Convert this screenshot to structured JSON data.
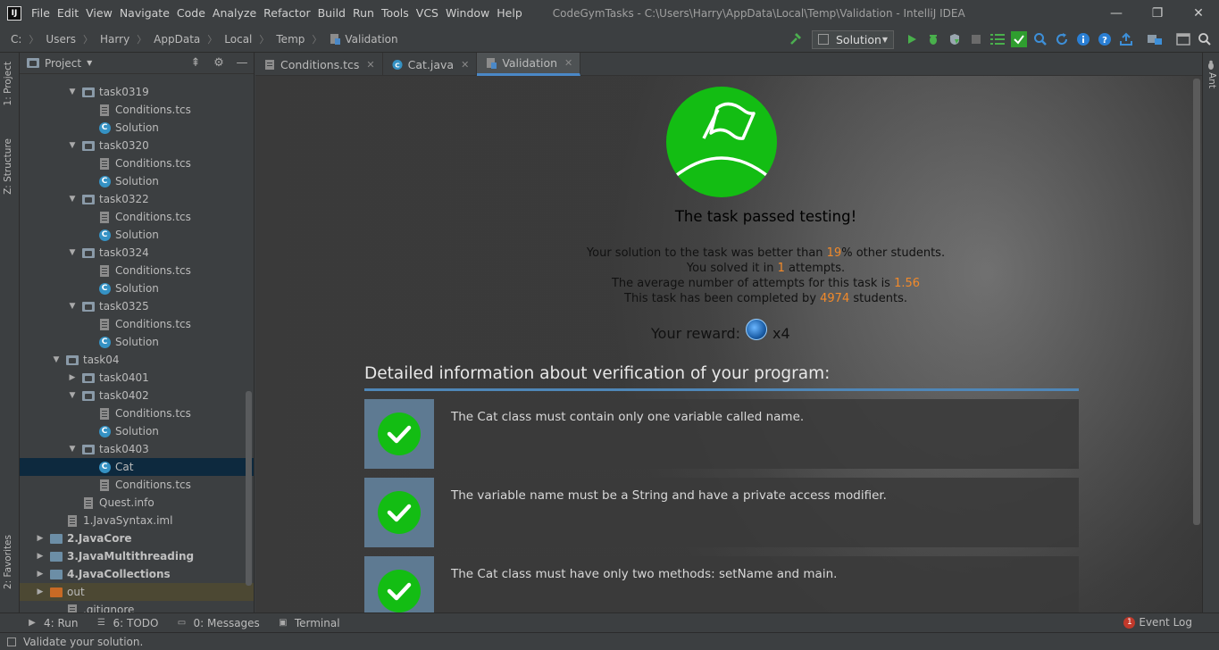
{
  "app": {
    "icon_letter": "IJ",
    "window_title": "CodeGymTasks - C:\\Users\\Harry\\AppData\\Local\\Temp\\Validation - IntelliJ IDEA",
    "menu": [
      "File",
      "Edit",
      "View",
      "Navigate",
      "Code",
      "Analyze",
      "Refactor",
      "Build",
      "Run",
      "Tools",
      "VCS",
      "Window",
      "Help"
    ]
  },
  "window_controls": {
    "minimize": "—",
    "restore": "❐",
    "close": "✕"
  },
  "breadcrumb": [
    "C:",
    "Users",
    "Harry",
    "AppData",
    "Local",
    "Temp",
    "Validation"
  ],
  "run_config": {
    "label": "Solution"
  },
  "left_strip": {
    "project": "1: Project",
    "structure": "Z: Structure",
    "favorites": "2: Favorites"
  },
  "right_strip": {
    "ant": "Ant"
  },
  "project_panel": {
    "title": "Project",
    "tree": [
      {
        "label": "task0319",
        "type": "folder",
        "depth": 2,
        "expanded": true
      },
      {
        "label": "Conditions.tcs",
        "type": "file",
        "depth": 3
      },
      {
        "label": "Solution",
        "type": "class",
        "depth": 3
      },
      {
        "label": "task0320",
        "type": "folder",
        "depth": 2,
        "expanded": true
      },
      {
        "label": "Conditions.tcs",
        "type": "file",
        "depth": 3
      },
      {
        "label": "Solution",
        "type": "class",
        "depth": 3
      },
      {
        "label": "task0322",
        "type": "folder",
        "depth": 2,
        "expanded": true
      },
      {
        "label": "Conditions.tcs",
        "type": "file",
        "depth": 3
      },
      {
        "label": "Solution",
        "type": "class",
        "depth": 3
      },
      {
        "label": "task0324",
        "type": "folder",
        "depth": 2,
        "expanded": true
      },
      {
        "label": "Conditions.tcs",
        "type": "file",
        "depth": 3
      },
      {
        "label": "Solution",
        "type": "class",
        "depth": 3
      },
      {
        "label": "task0325",
        "type": "folder",
        "depth": 2,
        "expanded": true
      },
      {
        "label": "Conditions.tcs",
        "type": "file",
        "depth": 3
      },
      {
        "label": "Solution",
        "type": "class",
        "depth": 3
      },
      {
        "label": "task04",
        "type": "folder",
        "depth": 1,
        "expanded": true
      },
      {
        "label": "task0401",
        "type": "folder",
        "depth": 2,
        "expanded": false
      },
      {
        "label": "task0402",
        "type": "folder",
        "depth": 2,
        "expanded": true
      },
      {
        "label": "Conditions.tcs",
        "type": "file",
        "depth": 3
      },
      {
        "label": "Solution",
        "type": "class",
        "depth": 3
      },
      {
        "label": "task0403",
        "type": "folder",
        "depth": 2,
        "expanded": true
      },
      {
        "label": "Cat",
        "type": "class",
        "depth": 3,
        "selected": true
      },
      {
        "label": "Conditions.tcs",
        "type": "file",
        "depth": 3
      },
      {
        "label": "Quest.info",
        "type": "file",
        "depth": 2
      },
      {
        "label": "1.JavaSyntax.iml",
        "type": "file",
        "depth": 1
      },
      {
        "label": "2.JavaCore",
        "type": "module",
        "depth": 0,
        "expanded": false,
        "bold": true
      },
      {
        "label": "3.JavaMultithreading",
        "type": "module",
        "depth": 0,
        "expanded": false,
        "bold": true
      },
      {
        "label": "4.JavaCollections",
        "type": "module",
        "depth": 0,
        "expanded": false,
        "bold": true
      },
      {
        "label": "out",
        "type": "out",
        "depth": 0,
        "expanded": false
      },
      {
        "label": ".gitignore",
        "type": "file",
        "depth": 1
      }
    ]
  },
  "tabs": [
    {
      "label": "Conditions.tcs",
      "active": false
    },
    {
      "label": "Cat.java",
      "active": false
    },
    {
      "label": "Validation",
      "active": true
    }
  ],
  "result": {
    "title": "The task passed testing!",
    "line1_pre": "Your solution to the task was better than ",
    "line1_val": "19",
    "line1_post": "% other students.",
    "line2_pre": "You solved it in ",
    "line2_val": "1",
    "line2_post": " attempts.",
    "line3_pre": "The average number of attempts for this task is ",
    "line3_val": "1.56",
    "line4_pre": "This task has been completed by ",
    "line4_val": "4974",
    "line4_post": " students.",
    "reward_label": "Your reward:",
    "reward_count": "x4",
    "highlight_color": "#f28a2a",
    "success_color": "#13bd13"
  },
  "details": {
    "title": "Detailed information about verification of your program:",
    "checks": [
      "The Cat class must contain only one variable called name.",
      "The variable name must be a String and have a private access modifier.",
      "The Cat class must have only two methods: setName and main."
    ]
  },
  "bottom_tabs": [
    {
      "label": "4: Run",
      "icon": "play-icon"
    },
    {
      "label": "6: TODO",
      "icon": "todo-icon"
    },
    {
      "label": "0: Messages",
      "icon": "messages-icon"
    },
    {
      "label": "Terminal",
      "icon": "terminal-icon"
    }
  ],
  "event_log": {
    "label": "Event Log",
    "count": "1"
  },
  "status": {
    "text": "Validate your solution."
  }
}
